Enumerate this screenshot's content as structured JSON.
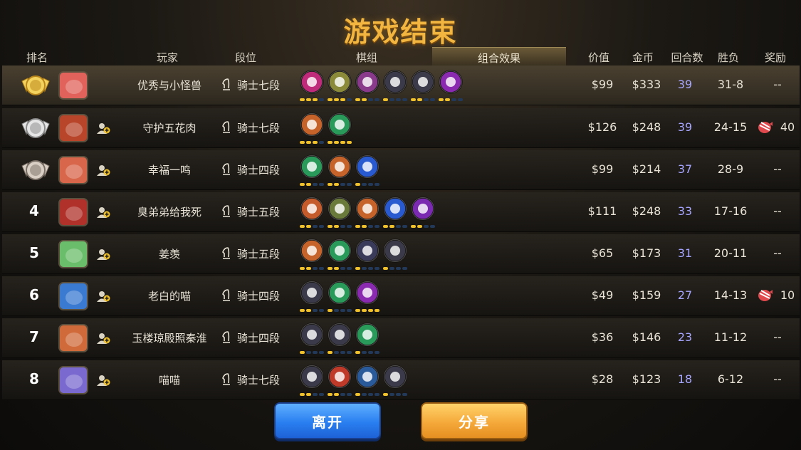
{
  "title": "游戏结束",
  "headers": {
    "rank": "排名",
    "player": "玩家",
    "tier": "段位",
    "pieces": "棋组",
    "effects": "组合效果",
    "value": "价值",
    "gold": "金币",
    "rounds": "回合数",
    "winloss": "胜负",
    "reward": "奖励"
  },
  "rows": [
    {
      "rank": "",
      "medal": "gold-medal",
      "name": "优秀与小怪兽",
      "tier": "骑士七段",
      "value": "$99",
      "gold": "$333",
      "rounds": "39",
      "wl": "31-8",
      "reward": "--",
      "avatar": "#e0625a",
      "add_friend": false,
      "synergies": [
        {
          "icon": "lightning-icon",
          "color": "#c02a7a"
        },
        {
          "icon": "owl-icon",
          "color": "#8a8a3a"
        },
        {
          "icon": "knight-icon",
          "color": "#8a3a8a"
        },
        {
          "icon": "helmet-icon",
          "color": "#3a3a4a"
        },
        {
          "icon": "cross-icon",
          "color": "#3a3a4a"
        },
        {
          "icon": "demon-icon",
          "color": "#8a2ab0"
        }
      ],
      "bars": [
        [
          1,
          1,
          1,
          0
        ],
        [
          1,
          1,
          1,
          0
        ],
        [
          1,
          1,
          0,
          0
        ],
        [
          1,
          0,
          0,
          0
        ],
        [
          1,
          1,
          0,
          0
        ],
        [
          1,
          1,
          0,
          0
        ]
      ]
    },
    {
      "rank": "",
      "medal": "silver-medal",
      "name": "守护五花肉",
      "tier": "骑士七段",
      "value": "$126",
      "gold": "$248",
      "rounds": "39",
      "wl": "24-15",
      "reward": "40",
      "avatar": "#b8442a",
      "add_friend": true,
      "synergies": [
        {
          "icon": "leaf-icon",
          "color": "#c5632a"
        },
        {
          "icon": "paw-icon",
          "color": "#2a9a5a"
        }
      ],
      "bars": [
        [
          1,
          1,
          1,
          0
        ],
        [
          1,
          1,
          1,
          1
        ]
      ]
    },
    {
      "rank": "",
      "medal": "bronze-medal",
      "name": "幸福一鸣",
      "tier": "骑士四段",
      "value": "$99",
      "gold": "$214",
      "rounds": "37",
      "wl": "28-9",
      "reward": "--",
      "avatar": "#d8664a",
      "add_friend": true,
      "synergies": [
        {
          "icon": "paw-icon",
          "color": "#2a9a5a"
        },
        {
          "icon": "leaf-icon",
          "color": "#c5632a"
        },
        {
          "icon": "carrot-icon",
          "color": "#2a5ad0"
        }
      ],
      "bars": [
        [
          1,
          1,
          0,
          0
        ],
        [
          1,
          1,
          0,
          0
        ],
        [
          1,
          0,
          0,
          0
        ]
      ]
    },
    {
      "rank": "4",
      "medal": "",
      "name": "臭弟弟给我死",
      "tier": "骑士五段",
      "value": "$111",
      "gold": "$248",
      "rounds": "33",
      "wl": "17-16",
      "reward": "--",
      "avatar": "#b0302a",
      "add_friend": true,
      "synergies": [
        {
          "icon": "viking-icon",
          "color": "#c55a2a"
        },
        {
          "icon": "bow-icon",
          "color": "#6a7a3a"
        },
        {
          "icon": "leaf-icon",
          "color": "#c5632a"
        },
        {
          "icon": "carrot-icon",
          "color": "#2a5ad0"
        },
        {
          "icon": "fist-icon",
          "color": "#7a2ab0"
        }
      ],
      "bars": [
        [
          1,
          1,
          0,
          0
        ],
        [
          1,
          1,
          0,
          0
        ],
        [
          1,
          1,
          0,
          0
        ],
        [
          1,
          1,
          0,
          0
        ],
        [
          1,
          1,
          0,
          0
        ]
      ]
    },
    {
      "rank": "5",
      "medal": "",
      "name": "姜羡",
      "tier": "骑士五段",
      "value": "$65",
      "gold": "$173",
      "rounds": "31",
      "wl": "20-11",
      "reward": "--",
      "avatar": "#6abd6a",
      "add_friend": true,
      "synergies": [
        {
          "icon": "leaf-icon",
          "color": "#c5632a"
        },
        {
          "icon": "paw-icon",
          "color": "#2a9a5a"
        },
        {
          "icon": "robot-icon",
          "color": "#3a3a5a"
        },
        {
          "icon": "chain-icon",
          "color": "#3a3a4a"
        }
      ],
      "bars": [
        [
          1,
          1,
          0,
          0
        ],
        [
          1,
          1,
          0,
          0
        ],
        [
          1,
          0,
          0,
          0
        ],
        [
          1,
          0,
          0,
          0
        ]
      ]
    },
    {
      "rank": "6",
      "medal": "",
      "name": "老白的喵",
      "tier": "骑士四段",
      "value": "$49",
      "gold": "$159",
      "rounds": "27",
      "wl": "14-13",
      "reward": "10",
      "avatar": "#3a7ad0",
      "add_friend": true,
      "synergies": [
        {
          "icon": "axe-icon",
          "color": "#3a3a4a"
        },
        {
          "icon": "paw-icon",
          "color": "#2a9a5a"
        },
        {
          "icon": "demon-icon",
          "color": "#8a2ab0"
        }
      ],
      "bars": [
        [
          1,
          1,
          0,
          0
        ],
        [
          1,
          0,
          0,
          0
        ],
        [
          1,
          1,
          1,
          1
        ]
      ]
    },
    {
      "rank": "7",
      "medal": "",
      "name": "玉楼琼殿照秦淮",
      "tier": "骑士四段",
      "value": "$36",
      "gold": "$146",
      "rounds": "23",
      "wl": "11-12",
      "reward": "--",
      "avatar": "#d06a3a",
      "add_friend": true,
      "synergies": [
        {
          "icon": "axe-icon",
          "color": "#3a3a4a"
        },
        {
          "icon": "helmet-icon",
          "color": "#3a3a4a"
        },
        {
          "icon": "paw-icon",
          "color": "#2a9a5a"
        }
      ],
      "bars": [
        [
          1,
          0,
          0,
          0
        ],
        [
          1,
          0,
          0,
          0
        ],
        [
          1,
          0,
          0,
          0
        ]
      ]
    },
    {
      "rank": "8",
      "medal": "",
      "name": "喵喵",
      "tier": "骑士七段",
      "value": "$28",
      "gold": "$123",
      "rounds": "18",
      "wl": "6-12",
      "reward": "--",
      "avatar": "#7a6ad0",
      "add_friend": true,
      "synergies": [
        {
          "icon": "gear-icon",
          "color": "#3a3a4a"
        },
        {
          "icon": "ogre-icon",
          "color": "#c03a2a"
        },
        {
          "icon": "question-icon",
          "color": "#2a5a9a"
        },
        {
          "icon": "helmet-icon",
          "color": "#3a3a4a"
        }
      ],
      "bars": [
        [
          1,
          1,
          0,
          0
        ],
        [
          1,
          1,
          0,
          0
        ],
        [
          1,
          0,
          0,
          0
        ],
        [
          1,
          0,
          0,
          0
        ]
      ]
    }
  ],
  "buttons": {
    "leave": "离开",
    "share": "分享"
  }
}
